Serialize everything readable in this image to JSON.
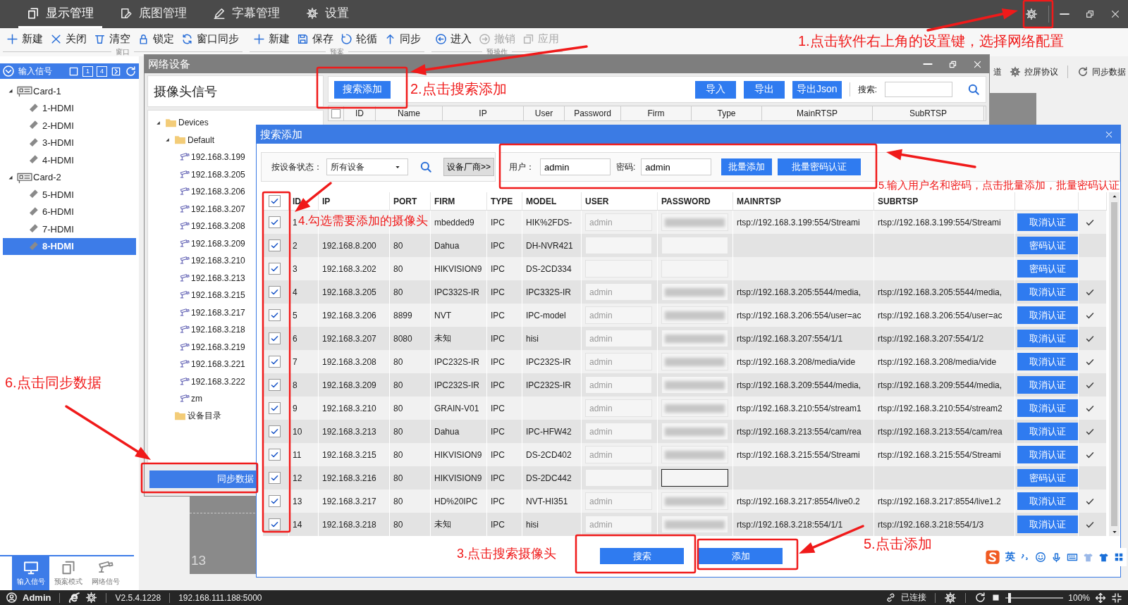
{
  "top_tabs": [
    {
      "label": "显示管理",
      "selected": true
    },
    {
      "label": "底图管理",
      "selected": false
    },
    {
      "label": "字幕管理",
      "selected": false
    },
    {
      "label": "设置",
      "selected": false
    }
  ],
  "toolbar_groups": [
    {
      "label": "窗口",
      "items": [
        {
          "label": "新建",
          "disabled": false
        },
        {
          "label": "关闭",
          "disabled": false
        },
        {
          "label": "清空",
          "disabled": false
        },
        {
          "label": "锁定",
          "disabled": false
        },
        {
          "label": "窗口同步",
          "disabled": false
        }
      ]
    },
    {
      "label": "预案",
      "items": [
        {
          "label": "新建",
          "disabled": false
        },
        {
          "label": "保存",
          "disabled": false
        },
        {
          "label": "轮循",
          "disabled": false
        },
        {
          "label": "同步",
          "disabled": false
        }
      ]
    },
    {
      "label": "预操作",
      "items": [
        {
          "label": "进入",
          "disabled": false
        },
        {
          "label": "撤销",
          "disabled": true
        },
        {
          "label": "应用",
          "disabled": true
        }
      ]
    }
  ],
  "input_panel": {
    "title": "输入信号",
    "layout_buttons": [
      "1",
      "4"
    ],
    "tree": [
      {
        "label": "Card-1",
        "expanded": true,
        "children": [
          {
            "label": "1-HDMI",
            "selected": false
          },
          {
            "label": "2-HDMI",
            "selected": false
          },
          {
            "label": "3-HDMI",
            "selected": false
          },
          {
            "label": "4-HDMI",
            "selected": false
          }
        ]
      },
      {
        "label": "Card-2",
        "expanded": true,
        "children": [
          {
            "label": "5-HDMI",
            "selected": false
          },
          {
            "label": "6-HDMI",
            "selected": false
          },
          {
            "label": "7-HDMI",
            "selected": false
          },
          {
            "label": "8-HDMI",
            "selected": true
          }
        ]
      }
    ]
  },
  "bottom_tabs": [
    {
      "label": "输入信号",
      "selected": true
    },
    {
      "label": "预案模式",
      "selected": false
    },
    {
      "label": "网络信号",
      "selected": false
    }
  ],
  "workspace": {
    "partial_label": "道",
    "tools": [
      "控屏协议",
      "同步数据"
    ],
    "canvas_label": "13"
  },
  "network_window": {
    "title": "网络设备",
    "panel_title": "摄像头信号",
    "tree": [
      {
        "label": "Devices",
        "kind": "folder",
        "expanded": true,
        "children": [
          {
            "label": "Default",
            "kind": "folder",
            "expanded": true,
            "children": [
              {
                "label": "192.168.3.199",
                "kind": "camera"
              },
              {
                "label": "192.168.3.205",
                "kind": "camera"
              },
              {
                "label": "192.168.3.206",
                "kind": "camera"
              },
              {
                "label": "192.168.3.207",
                "kind": "camera"
              },
              {
                "label": "192.168.3.208",
                "kind": "camera"
              },
              {
                "label": "192.168.3.209",
                "kind": "camera"
              },
              {
                "label": "192.168.3.210",
                "kind": "camera"
              },
              {
                "label": "192.168.3.213",
                "kind": "camera"
              },
              {
                "label": "192.168.3.215",
                "kind": "camera"
              },
              {
                "label": "192.168.3.217",
                "kind": "camera"
              },
              {
                "label": "192.168.3.218",
                "kind": "camera"
              },
              {
                "label": "192.168.3.219",
                "kind": "camera"
              },
              {
                "label": "192.168.3.221",
                "kind": "camera"
              },
              {
                "label": "192.168.3.222",
                "kind": "camera"
              },
              {
                "label": "zm",
                "kind": "camera"
              }
            ]
          },
          {
            "label": "设备目录",
            "kind": "folder"
          }
        ]
      }
    ],
    "sync_button": "同步数据",
    "search_add_button": "搜索添加",
    "buttons": [
      "导入",
      "导出",
      "导出Json"
    ],
    "search_label": "搜索:",
    "select_all": false,
    "columns": [
      "ID",
      "Name",
      "IP",
      "User",
      "Password",
      "Firm",
      "Type",
      "MainRTSP",
      "SubRTSP"
    ]
  },
  "search_dialog": {
    "title": "搜索添加",
    "status_label": "按设备状态：",
    "status_value": "所有设备",
    "vendor_button": "设备厂商>>",
    "user_label": "用户：",
    "user_value": "admin",
    "password_label": "密码:",
    "password_value": "admin",
    "batch_add": "批量添加",
    "batch_auth": "批量密码认证",
    "all_checked": true,
    "columns": [
      "ID",
      "IP",
      "PORT",
      "FIRM",
      "TYPE",
      "MODEL",
      "USER",
      "PASSWORD",
      "MAINRTSP",
      "SUBRTSP"
    ],
    "rows": [
      {
        "checked": true,
        "id": "1",
        "firm": "mbedded9",
        "type": "IPC",
        "model": "HIK%2FDS-",
        "user": "admin",
        "password_set": true,
        "password_focused": false,
        "main_rtsp": "rtsp://192.168.3.199:554/Streami",
        "sub_rtsp": "rtsp://192.168.3.199:554/Streami",
        "action": "取消认证",
        "verified": true
      },
      {
        "checked": true,
        "id": "2",
        "ip": "192.168.8.200",
        "port": "80",
        "firm": "Dahua",
        "type": "IPC",
        "model": "DH-NVR421",
        "password_set": false,
        "password_focused": false,
        "action": "密码认证",
        "verified": false
      },
      {
        "checked": true,
        "id": "3",
        "ip": "192.168.3.202",
        "port": "80",
        "firm": "HIKVISION9",
        "type": "IPC",
        "model": "DS-2CD334",
        "password_set": false,
        "password_focused": false,
        "action": "密码认证",
        "verified": false
      },
      {
        "checked": true,
        "id": "4",
        "ip": "192.168.3.205",
        "port": "80",
        "firm": "IPC332S-IR",
        "type": "IPC",
        "model": "IPC332S-IR",
        "user": "admin",
        "password_set": true,
        "password_focused": false,
        "main_rtsp": "rtsp://192.168.3.205:5544/media,",
        "sub_rtsp": "rtsp://192.168.3.205:5544/media,",
        "action": "取消认证",
        "verified": true
      },
      {
        "checked": true,
        "id": "5",
        "ip": "192.168.3.206",
        "port": "8899",
        "firm": "NVT",
        "type": "IPC",
        "model": "IPC-model",
        "user": "admin",
        "password_set": true,
        "password_focused": false,
        "main_rtsp": "rtsp://192.168.3.206:554/user=ac",
        "sub_rtsp": "rtsp://192.168.3.206:554/user=ac",
        "action": "取消认证",
        "verified": true
      },
      {
        "checked": true,
        "id": "6",
        "ip": "192.168.3.207",
        "port": "8080",
        "firm": "未知",
        "type": "IPC",
        "model": "hisi",
        "user": "admin",
        "password_set": true,
        "password_focused": false,
        "main_rtsp": "rtsp://192.168.3.207:554/1/1",
        "sub_rtsp": "rtsp://192.168.3.207:554/1/2",
        "action": "取消认证",
        "verified": true
      },
      {
        "checked": true,
        "id": "7",
        "ip": "192.168.3.208",
        "port": "80",
        "firm": "IPC232S-IR",
        "type": "IPC",
        "model": "IPC232S-IR",
        "user": "admin",
        "password_set": true,
        "password_focused": false,
        "main_rtsp": "rtsp://192.168.3.208/media/vide",
        "sub_rtsp": "rtsp://192.168.3.208/media/vide",
        "action": "取消认证",
        "verified": true
      },
      {
        "checked": true,
        "id": "8",
        "ip": "192.168.3.209",
        "port": "80",
        "firm": "IPC232S-IR",
        "type": "IPC",
        "model": "IPC232S-IR",
        "user": "admin",
        "password_set": true,
        "password_focused": false,
        "main_rtsp": "rtsp://192.168.3.209:5544/media,",
        "sub_rtsp": "rtsp://192.168.3.209:5544/media,",
        "action": "取消认证",
        "verified": true
      },
      {
        "checked": true,
        "id": "9",
        "ip": "192.168.3.210",
        "port": "80",
        "firm": "GRAIN-V01",
        "type": "IPC",
        "user": "admin",
        "password_set": true,
        "password_focused": false,
        "main_rtsp": "rtsp://192.168.3.210:554/stream1",
        "sub_rtsp": "rtsp://192.168.3.210:554/stream2",
        "action": "取消认证",
        "verified": true
      },
      {
        "checked": true,
        "id": "10",
        "ip": "192.168.3.213",
        "port": "80",
        "firm": "Dahua",
        "type": "IPC",
        "model": "IPC-HFW42",
        "user": "admin",
        "password_set": true,
        "password_focused": false,
        "main_rtsp": "rtsp://192.168.3.213:554/cam/rea",
        "sub_rtsp": "rtsp://192.168.3.213:554/cam/rea",
        "action": "取消认证",
        "verified": true
      },
      {
        "checked": true,
        "id": "11",
        "ip": "192.168.3.215",
        "port": "80",
        "firm": "HIKVISION9",
        "type": "IPC",
        "model": "DS-2CD402",
        "user": "admin",
        "password_set": true,
        "password_focused": false,
        "main_rtsp": "rtsp://192.168.3.215:554/Streami",
        "sub_rtsp": "rtsp://192.168.3.215:554/Streami",
        "action": "取消认证",
        "verified": true
      },
      {
        "checked": true,
        "id": "12",
        "ip": "192.168.3.216",
        "port": "80",
        "firm": "HIKVISION9",
        "type": "IPC",
        "model": "DS-2DC442",
        "password_set": false,
        "password_focused": true,
        "action": "密码认证",
        "verified": false
      },
      {
        "checked": true,
        "id": "13",
        "ip": "192.168.3.217",
        "port": "80",
        "firm": "HD%20IPC",
        "type": "IPC",
        "model": "NVT-HI351",
        "user": "admin",
        "password_set": true,
        "password_focused": false,
        "main_rtsp": "rtsp://192.168.3.217:8554/live0.2",
        "sub_rtsp": "rtsp://192.168.3.217:8554/live1.2",
        "action": "取消认证",
        "verified": true
      },
      {
        "checked": true,
        "id": "14",
        "ip": "192.168.3.218",
        "port": "80",
        "firm": "未知",
        "type": "IPC",
        "model": "hisi",
        "user": "admin",
        "password_set": true,
        "password_focused": false,
        "main_rtsp": "rtsp://192.168.3.218:554/1/1",
        "sub_rtsp": "rtsp://192.168.3.218:554/1/3",
        "action": "取消认证",
        "verified": true
      }
    ],
    "search_button": "搜索",
    "add_button": "添加"
  },
  "ime_bar": {
    "mode": "英"
  },
  "status_bar": {
    "user": "Admin",
    "version": "V2.5.4.1228",
    "address": "192.168.111.188:5000",
    "connection": "已连接",
    "zoom_slider": {
      "level": 0.05
    },
    "zoom": "100%"
  },
  "annotations": [
    {
      "text": "1.点击软件右上角的设置键，选择网络配置"
    },
    {
      "text": "2.点击搜索添加"
    },
    {
      "text": "3.点击搜索摄像头"
    },
    {
      "text": "4.勾选需要添加的摄像头"
    },
    {
      "text": "5.输入用户名和密码，点击批量添加，批量密码认证"
    },
    {
      "text": "5.点击添加"
    },
    {
      "text": "6.点击同步数据"
    }
  ]
}
